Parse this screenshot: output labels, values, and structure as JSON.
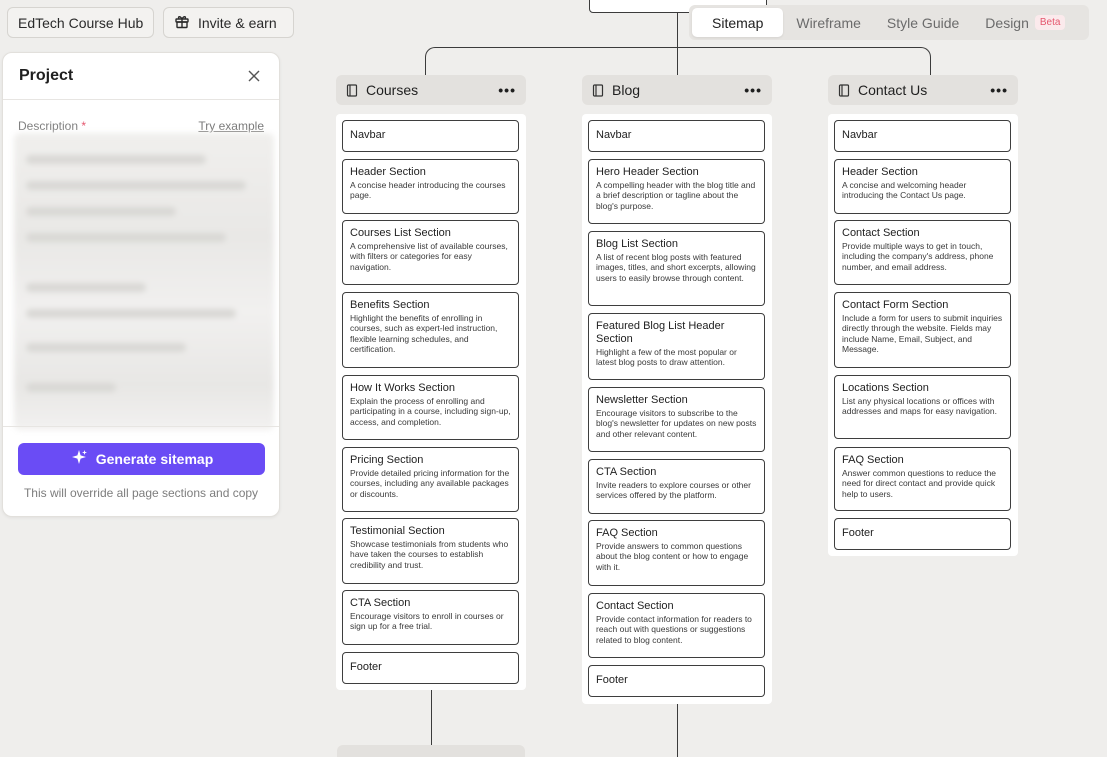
{
  "header": {
    "project_button": "EdTech Course Hub",
    "invite_button": "Invite & earn"
  },
  "tabs": [
    {
      "label": "Sitemap"
    },
    {
      "label": "Wireframe"
    },
    {
      "label": "Style Guide"
    },
    {
      "label": "Design",
      "badge": "Beta"
    }
  ],
  "panel": {
    "title": "Project",
    "description_label": "Description",
    "required_mark": "*",
    "try_example": "Try example",
    "generate_button": "Generate sitemap",
    "override_note": "This will override all page sections and copy"
  },
  "columns": [
    {
      "title": "Courses",
      "sections": [
        {
          "title": "Navbar",
          "desc": ""
        },
        {
          "title": "Header Section",
          "desc": "A concise header introducing the courses page."
        },
        {
          "title": "Courses List Section",
          "desc": "A comprehensive list of available courses, with filters or categories for easy navigation."
        },
        {
          "title": "Benefits Section",
          "desc": "Highlight the benefits of enrolling in courses, such as expert-led instruction, flexible learning schedules, and certification."
        },
        {
          "title": "How It Works Section",
          "desc": "Explain the process of enrolling and participating in a course, including sign-up, access, and completion."
        },
        {
          "title": "Pricing Section",
          "desc": "Provide detailed pricing information for the courses, including any available packages or discounts."
        },
        {
          "title": "Testimonial Section",
          "desc": "Showcase testimonials from students who have taken the courses to establish credibility and trust."
        },
        {
          "title": "CTA Section",
          "desc": "Encourage visitors to enroll in courses or sign up for a free trial."
        },
        {
          "title": "Footer",
          "desc": ""
        }
      ]
    },
    {
      "title": "Blog",
      "sections": [
        {
          "title": "Navbar",
          "desc": ""
        },
        {
          "title": "Hero Header Section",
          "desc": "A compelling header with the blog title and a brief description or tagline about the blog's purpose."
        },
        {
          "title": "Blog List Section",
          "desc": "A list of recent blog posts with featured images, titles, and short excerpts, allowing users to easily browse through content."
        },
        {
          "title": "Featured Blog List Header Section",
          "desc": "Highlight a few of the most popular or latest blog posts to draw attention."
        },
        {
          "title": "Newsletter Section",
          "desc": "Encourage visitors to subscribe to the blog's newsletter for updates on new posts and other relevant content."
        },
        {
          "title": "CTA Section",
          "desc": "Invite readers to explore courses or other services offered by the platform."
        },
        {
          "title": "FAQ Section",
          "desc": "Provide answers to common questions about the blog content or how to engage with it."
        },
        {
          "title": "Contact Section",
          "desc": "Provide contact information for readers to reach out with questions or suggestions related to blog content."
        },
        {
          "title": "Footer",
          "desc": ""
        }
      ]
    },
    {
      "title": "Contact Us",
      "sections": [
        {
          "title": "Navbar",
          "desc": ""
        },
        {
          "title": "Header Section",
          "desc": "A concise and welcoming header introducing the Contact Us page."
        },
        {
          "title": "Contact Section",
          "desc": "Provide multiple ways to get in touch, including the company's address, phone number, and email address."
        },
        {
          "title": "Contact Form Section",
          "desc": "Include a form for users to submit inquiries directly through the website. Fields may include Name, Email, Subject, and Message."
        },
        {
          "title": "Locations Section",
          "desc": "List any physical locations or offices with addresses and maps for easy navigation."
        },
        {
          "title": "FAQ Section",
          "desc": "Answer common questions to reduce the need for direct contact and provide quick help to users."
        },
        {
          "title": "Footer",
          "desc": ""
        }
      ]
    }
  ]
}
